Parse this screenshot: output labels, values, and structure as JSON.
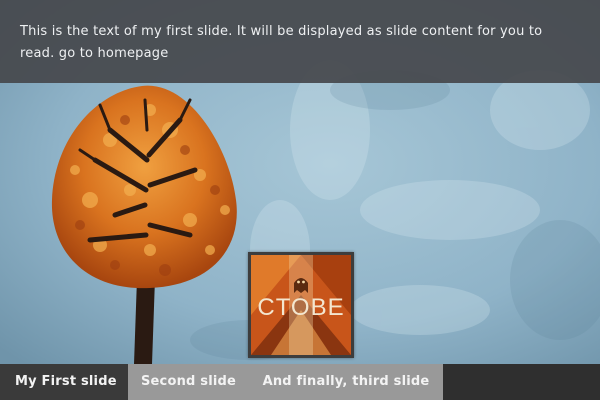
{
  "slide": {
    "caption_text": "This is the text of my first slide. It will be displayed as slide content for you to read.",
    "caption_link": "go to homepage",
    "thumbnail_text": "CTOBE"
  },
  "tabs": [
    {
      "label": "My First slide",
      "active": true
    },
    {
      "label": "Second slide",
      "active": false
    },
    {
      "label": "And finally, third slide",
      "active": false
    }
  ],
  "colors": {
    "caption_bg": "#46484c",
    "tab_bar_bg": "#2f2f2f",
    "tab_inactive_bg": "#999999",
    "sky": "#8fb3c8",
    "leaves": "#d2691e"
  }
}
